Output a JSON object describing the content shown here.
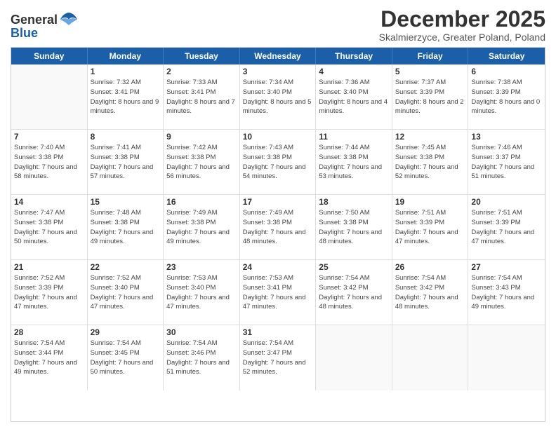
{
  "header": {
    "logo_general": "General",
    "logo_blue": "Blue",
    "title": "December 2025",
    "subtitle": "Skalmierzyce, Greater Poland, Poland"
  },
  "weekdays": [
    "Sunday",
    "Monday",
    "Tuesday",
    "Wednesday",
    "Thursday",
    "Friday",
    "Saturday"
  ],
  "weeks": [
    [
      {
        "day": "",
        "sunrise": "",
        "sunset": "",
        "daylight": ""
      },
      {
        "day": "1",
        "sunrise": "Sunrise: 7:32 AM",
        "sunset": "Sunset: 3:41 PM",
        "daylight": "Daylight: 8 hours and 9 minutes."
      },
      {
        "day": "2",
        "sunrise": "Sunrise: 7:33 AM",
        "sunset": "Sunset: 3:41 PM",
        "daylight": "Daylight: 8 hours and 7 minutes."
      },
      {
        "day": "3",
        "sunrise": "Sunrise: 7:34 AM",
        "sunset": "Sunset: 3:40 PM",
        "daylight": "Daylight: 8 hours and 5 minutes."
      },
      {
        "day": "4",
        "sunrise": "Sunrise: 7:36 AM",
        "sunset": "Sunset: 3:40 PM",
        "daylight": "Daylight: 8 hours and 4 minutes."
      },
      {
        "day": "5",
        "sunrise": "Sunrise: 7:37 AM",
        "sunset": "Sunset: 3:39 PM",
        "daylight": "Daylight: 8 hours and 2 minutes."
      },
      {
        "day": "6",
        "sunrise": "Sunrise: 7:38 AM",
        "sunset": "Sunset: 3:39 PM",
        "daylight": "Daylight: 8 hours and 0 minutes."
      }
    ],
    [
      {
        "day": "7",
        "sunrise": "Sunrise: 7:40 AM",
        "sunset": "Sunset: 3:38 PM",
        "daylight": "Daylight: 7 hours and 58 minutes."
      },
      {
        "day": "8",
        "sunrise": "Sunrise: 7:41 AM",
        "sunset": "Sunset: 3:38 PM",
        "daylight": "Daylight: 7 hours and 57 minutes."
      },
      {
        "day": "9",
        "sunrise": "Sunrise: 7:42 AM",
        "sunset": "Sunset: 3:38 PM",
        "daylight": "Daylight: 7 hours and 56 minutes."
      },
      {
        "day": "10",
        "sunrise": "Sunrise: 7:43 AM",
        "sunset": "Sunset: 3:38 PM",
        "daylight": "Daylight: 7 hours and 54 minutes."
      },
      {
        "day": "11",
        "sunrise": "Sunrise: 7:44 AM",
        "sunset": "Sunset: 3:38 PM",
        "daylight": "Daylight: 7 hours and 53 minutes."
      },
      {
        "day": "12",
        "sunrise": "Sunrise: 7:45 AM",
        "sunset": "Sunset: 3:38 PM",
        "daylight": "Daylight: 7 hours and 52 minutes."
      },
      {
        "day": "13",
        "sunrise": "Sunrise: 7:46 AM",
        "sunset": "Sunset: 3:37 PM",
        "daylight": "Daylight: 7 hours and 51 minutes."
      }
    ],
    [
      {
        "day": "14",
        "sunrise": "Sunrise: 7:47 AM",
        "sunset": "Sunset: 3:38 PM",
        "daylight": "Daylight: 7 hours and 50 minutes."
      },
      {
        "day": "15",
        "sunrise": "Sunrise: 7:48 AM",
        "sunset": "Sunset: 3:38 PM",
        "daylight": "Daylight: 7 hours and 49 minutes."
      },
      {
        "day": "16",
        "sunrise": "Sunrise: 7:49 AM",
        "sunset": "Sunset: 3:38 PM",
        "daylight": "Daylight: 7 hours and 49 minutes."
      },
      {
        "day": "17",
        "sunrise": "Sunrise: 7:49 AM",
        "sunset": "Sunset: 3:38 PM",
        "daylight": "Daylight: 7 hours and 48 minutes."
      },
      {
        "day": "18",
        "sunrise": "Sunrise: 7:50 AM",
        "sunset": "Sunset: 3:38 PM",
        "daylight": "Daylight: 7 hours and 48 minutes."
      },
      {
        "day": "19",
        "sunrise": "Sunrise: 7:51 AM",
        "sunset": "Sunset: 3:39 PM",
        "daylight": "Daylight: 7 hours and 47 minutes."
      },
      {
        "day": "20",
        "sunrise": "Sunrise: 7:51 AM",
        "sunset": "Sunset: 3:39 PM",
        "daylight": "Daylight: 7 hours and 47 minutes."
      }
    ],
    [
      {
        "day": "21",
        "sunrise": "Sunrise: 7:52 AM",
        "sunset": "Sunset: 3:39 PM",
        "daylight": "Daylight: 7 hours and 47 minutes."
      },
      {
        "day": "22",
        "sunrise": "Sunrise: 7:52 AM",
        "sunset": "Sunset: 3:40 PM",
        "daylight": "Daylight: 7 hours and 47 minutes."
      },
      {
        "day": "23",
        "sunrise": "Sunrise: 7:53 AM",
        "sunset": "Sunset: 3:40 PM",
        "daylight": "Daylight: 7 hours and 47 minutes."
      },
      {
        "day": "24",
        "sunrise": "Sunrise: 7:53 AM",
        "sunset": "Sunset: 3:41 PM",
        "daylight": "Daylight: 7 hours and 47 minutes."
      },
      {
        "day": "25",
        "sunrise": "Sunrise: 7:54 AM",
        "sunset": "Sunset: 3:42 PM",
        "daylight": "Daylight: 7 hours and 48 minutes."
      },
      {
        "day": "26",
        "sunrise": "Sunrise: 7:54 AM",
        "sunset": "Sunset: 3:42 PM",
        "daylight": "Daylight: 7 hours and 48 minutes."
      },
      {
        "day": "27",
        "sunrise": "Sunrise: 7:54 AM",
        "sunset": "Sunset: 3:43 PM",
        "daylight": "Daylight: 7 hours and 49 minutes."
      }
    ],
    [
      {
        "day": "28",
        "sunrise": "Sunrise: 7:54 AM",
        "sunset": "Sunset: 3:44 PM",
        "daylight": "Daylight: 7 hours and 49 minutes."
      },
      {
        "day": "29",
        "sunrise": "Sunrise: 7:54 AM",
        "sunset": "Sunset: 3:45 PM",
        "daylight": "Daylight: 7 hours and 50 minutes."
      },
      {
        "day": "30",
        "sunrise": "Sunrise: 7:54 AM",
        "sunset": "Sunset: 3:46 PM",
        "daylight": "Daylight: 7 hours and 51 minutes."
      },
      {
        "day": "31",
        "sunrise": "Sunrise: 7:54 AM",
        "sunset": "Sunset: 3:47 PM",
        "daylight": "Daylight: 7 hours and 52 minutes."
      },
      {
        "day": "",
        "sunrise": "",
        "sunset": "",
        "daylight": ""
      },
      {
        "day": "",
        "sunrise": "",
        "sunset": "",
        "daylight": ""
      },
      {
        "day": "",
        "sunrise": "",
        "sunset": "",
        "daylight": ""
      }
    ]
  ]
}
